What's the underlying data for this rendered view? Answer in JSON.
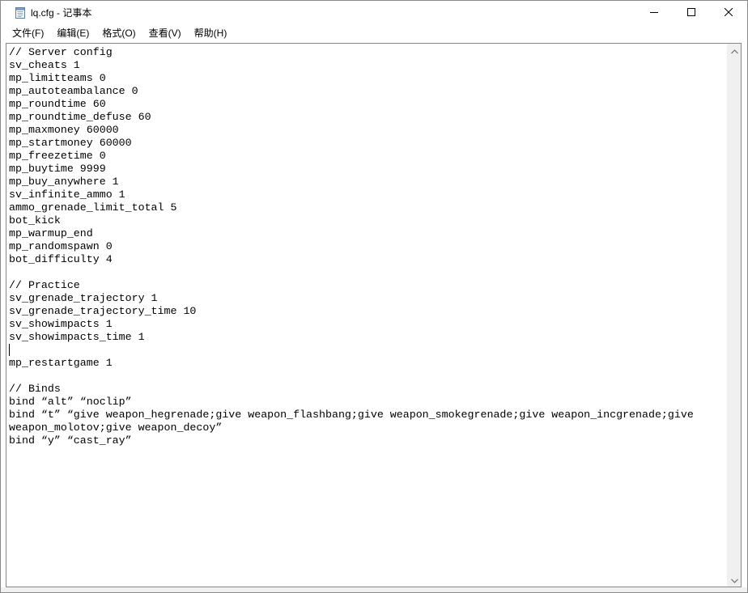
{
  "window": {
    "title": "lq.cfg - 记事本",
    "minimize_label": "minimize",
    "maximize_label": "maximize",
    "close_label": "close"
  },
  "menu": {
    "items": [
      {
        "label": "文件(F)"
      },
      {
        "label": "编辑(E)"
      },
      {
        "label": "格式(O)"
      },
      {
        "label": "查看(V)"
      },
      {
        "label": "帮助(H)"
      }
    ]
  },
  "editor": {
    "lines": [
      "// Server config",
      "sv_cheats 1",
      "mp_limitteams 0",
      "mp_autoteambalance 0",
      "mp_roundtime 60",
      "mp_roundtime_defuse 60",
      "mp_maxmoney 60000",
      "mp_startmoney 60000",
      "mp_freezetime 0",
      "mp_buytime 9999",
      "mp_buy_anywhere 1",
      "sv_infinite_ammo 1",
      "ammo_grenade_limit_total 5",
      "bot_kick",
      "mp_warmup_end",
      "mp_randomspawn 0",
      "bot_difficulty 4",
      "",
      "// Practice",
      "sv_grenade_trajectory 1",
      "sv_grenade_trajectory_time 10",
      "sv_showimpacts 1",
      "sv_showimpacts_time 1",
      "",
      "mp_restartgame 1",
      "",
      "// Binds",
      "bind “alt” “noclip”",
      "bind “t” “give weapon_hegrenade;give weapon_flashbang;give weapon_smokegrenade;give weapon_incgrenade;give",
      "weapon_molotov;give weapon_decoy”",
      "bind “y” “cast_ray”"
    ],
    "caret_line": 23
  },
  "colors": {
    "titlebar_bg": "#ffffff",
    "text": "#000000",
    "border": "#828790",
    "scrollbar": "#f0f0f0"
  },
  "icons": {
    "app": "notepad-icon",
    "minimize": "minimize-icon",
    "maximize": "maximize-icon",
    "close": "close-icon",
    "scroll_up": "chevron-up-icon",
    "scroll_down": "chevron-down-icon"
  }
}
